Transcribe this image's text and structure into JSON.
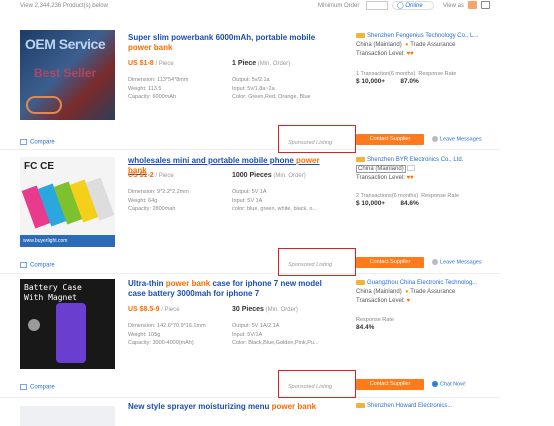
{
  "header": {
    "result_count": "View 2,344,236 Product(s) below",
    "min_order_label": "Minimum Order",
    "online_label": "Online",
    "view_as_label": "View as"
  },
  "products": [
    {
      "thumb_text1": "OEM Service",
      "thumb_text2": "Best Seller",
      "title_pre": "Super slim powerbank 6000mAh, portable mobile ",
      "title_kw": "power bank",
      "title_post": "",
      "price": "US $1-8",
      "price_unit": " / Piece",
      "moq": "1 Piece",
      "moq_unit": " (Min. Order)",
      "specs_left": [
        "Dimension: 113*54*8mm",
        "Weight: 113.5",
        "Capacity: 6000mAh"
      ],
      "specs_right": [
        "Output: 5v/2.1a",
        "Input: 5v/1.8a~2a",
        "Color: Green,Red, Orange, Blue"
      ],
      "sponsored": "Sponsored Listing",
      "compare": "Compare",
      "supplier": "Shenzhen Fengenius Technology Co., L...",
      "location": "China (Mainland)",
      "assurance": "Trade Assurance",
      "level": "Transaction Level:",
      "stat1_label": "1 Transaction(6 months)",
      "stat1_value": "10,000+",
      "stat2_label": "Response Rate",
      "stat2_value": "87.0%",
      "contact": "Contact Supplier",
      "message": "Leave Messages"
    },
    {
      "thumb_text1": "FC CE",
      "thumb_text2": "www.buyerlight.com",
      "title_pre": "wholesales mini and portable mobile phone ",
      "title_kw": "power bank",
      "title_post": "",
      "price": "US $1-2",
      "price_unit": " / Piece",
      "moq": "1000 Pieces",
      "moq_unit": " (Min. Order)",
      "specs_left": [
        "Dimension: 9*2.2*2.2mm",
        "Weight: 64g",
        "Capacity: 2800mah"
      ],
      "specs_right": [
        "Output: 5V 1A",
        "Input: 5V 1A",
        "color: blue, green, white, black, o..."
      ],
      "sponsored": "Sponsored Listing",
      "compare": "Compare",
      "supplier": "Shenzhen BYR Electronics Co., Ltd.",
      "location": "China (Mainland)",
      "assurance": "",
      "level": "Transaction Level:",
      "stat1_label": "2 Transactions(6 months)",
      "stat1_value": "10,000+",
      "stat2_label": "Response Rate",
      "stat2_value": "84.6%",
      "contact": "Contact Supplier",
      "message": "Leave Messages"
    },
    {
      "thumb_text1": "Battery Case",
      "thumb_text2": "With Magnet",
      "title_pre": "Ultra-thin ",
      "title_kw": "power bank",
      "title_post": " case for iphone 7 new model case battery 3000mah for iphone 7",
      "price": "US $8.5-9",
      "price_unit": " / Piece",
      "moq": "30 Pieces",
      "moq_unit": " (Min. Order)",
      "specs_left": [
        "Dimension: 142.6*70.9*16.1mm",
        "Weight: 105g",
        "Capacity: 3000-4000(mAh)"
      ],
      "specs_right": [
        "Output: 5V 1A/2.1A",
        "Input: 5V/1A",
        "Color: Black,Blue,Golden,Pink,Pu..."
      ],
      "sponsored": "Sponsored Listing",
      "compare": "Compare",
      "supplier": "Guangzhou China Electronic Technolog...",
      "location": "China (Mainland)",
      "assurance": "Trade Assurance",
      "level": "Transaction Level:",
      "stat1_label": "",
      "stat1_value": "",
      "stat2_label": "Response Rate",
      "stat2_value": "84.4%",
      "contact": "Contact Supplier",
      "message": "Chat Now!"
    }
  ],
  "next_item": {
    "title_pre": "New style sprayer moisturizing menu ",
    "title_kw": "power bank",
    "supplier": "Shenzhen Howard Electronics..."
  },
  "colors": {
    "accent": "#ff6a00",
    "link": "#1a4cb4",
    "highlight": "#e02020"
  }
}
